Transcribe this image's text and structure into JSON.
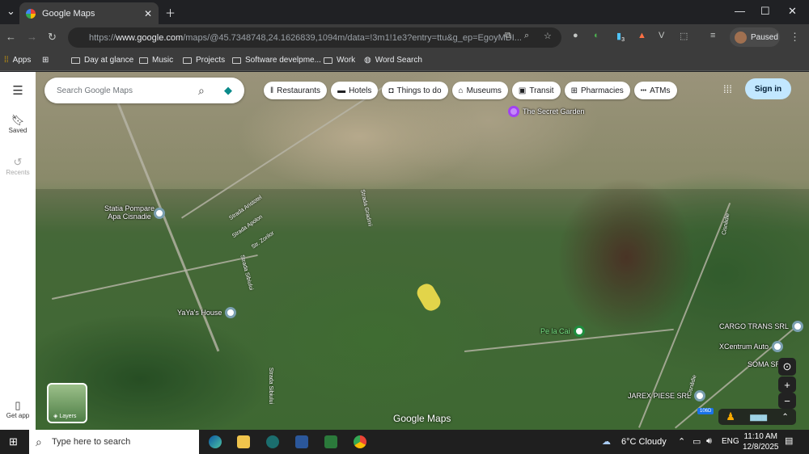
{
  "browser": {
    "tab_title": "Google Maps",
    "url_prefix": "https://",
    "url_domain": "www.google.com",
    "url_rest": "/maps/@45.7348748,24.1626839,1094m/data=!3m1!1e3?entry=ttu&g_ep=EgoyMDI...",
    "profile_status": "Paused",
    "extension_badge": "3",
    "bookmarks": [
      "Apps",
      "Day at glance",
      "Music",
      "Projects",
      "Software develpme...",
      "Work",
      "Word Search"
    ]
  },
  "sidebar": {
    "saved": "Saved",
    "recents": "Recents",
    "get_app": "Get app"
  },
  "maps": {
    "search_placeholder": "Search Google Maps",
    "chips": [
      "Restaurants",
      "Hotels",
      "Things to do",
      "Museums",
      "Transit",
      "Pharmacies",
      "ATMs"
    ],
    "sign_in": "Sign in",
    "layers": "Layers",
    "watermark": "Google Maps",
    "road_badge": "106D",
    "places": [
      "The Secret Garden",
      "Statia Pompare Apa Cisnadie",
      "YaYa's House",
      "Pe la Cai",
      "CARGO TRANS SRL",
      "XCentrum Auto",
      "SOMA SRL",
      "JAREX PIESE SRL"
    ],
    "streets": [
      "Strada Aristotel",
      "Strada Apolon",
      "Str. Zorilor",
      "Strada Sibiului",
      "Strada Sibiului",
      "Strada Gradinii",
      "Cisnădie",
      "Cisnădie"
    ]
  },
  "taskbar": {
    "search_placeholder": "Type here to search",
    "weather": "6°C  Cloudy",
    "lang": "ENG",
    "time": "11:10 AM",
    "date": "12/8/2025"
  }
}
